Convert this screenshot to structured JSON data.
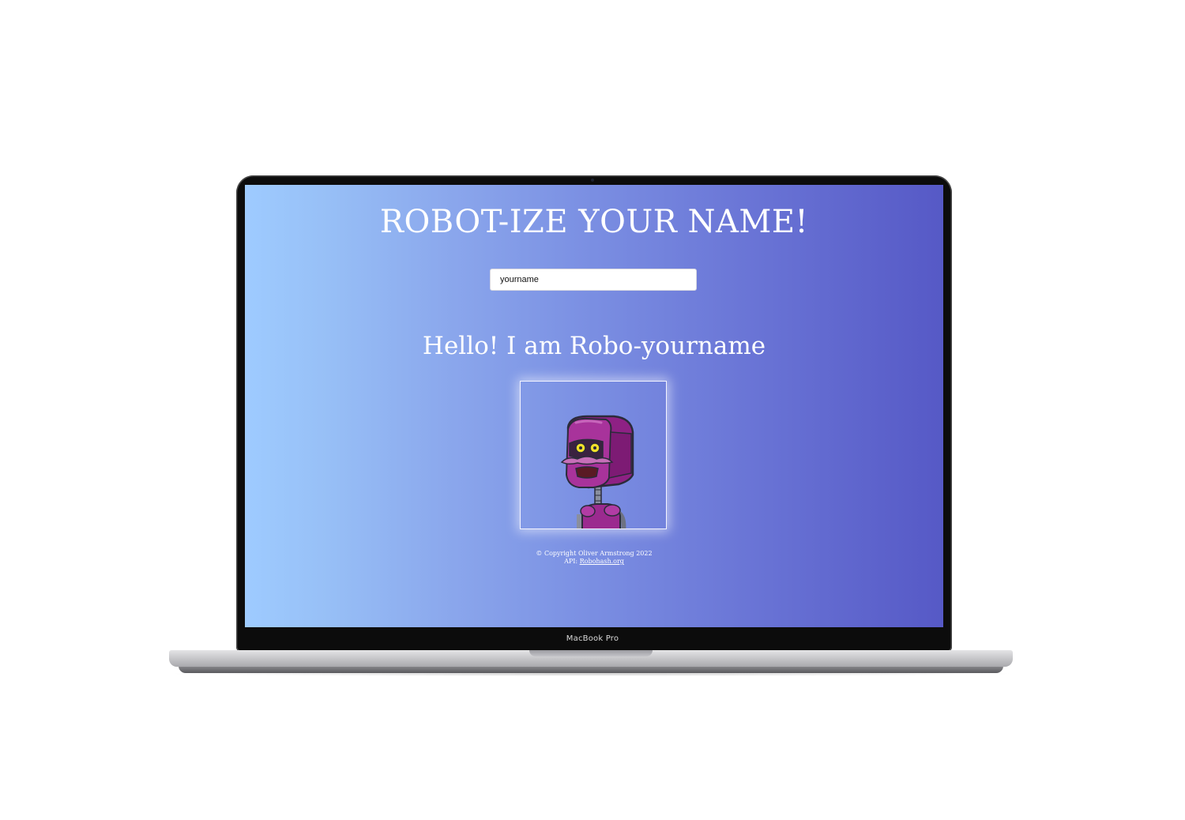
{
  "device": {
    "label": "MacBook Pro"
  },
  "page": {
    "title": "ROBOT-IZE YOUR NAME!",
    "input_value": "yourname",
    "greeting": "Hello! I am Robo-yourname",
    "robot_image": "robot-avatar",
    "footer": {
      "copyright": "© Copyright Oliver Armstrong 2022",
      "api_prefix": "API: ",
      "api_link": "Robohash.org"
    }
  },
  "colors": {
    "gradient_start": "#9ecbff",
    "gradient_end": "#5659c6",
    "robot_body": "#9b2a8f",
    "robot_eyes": "#f2e12a"
  }
}
